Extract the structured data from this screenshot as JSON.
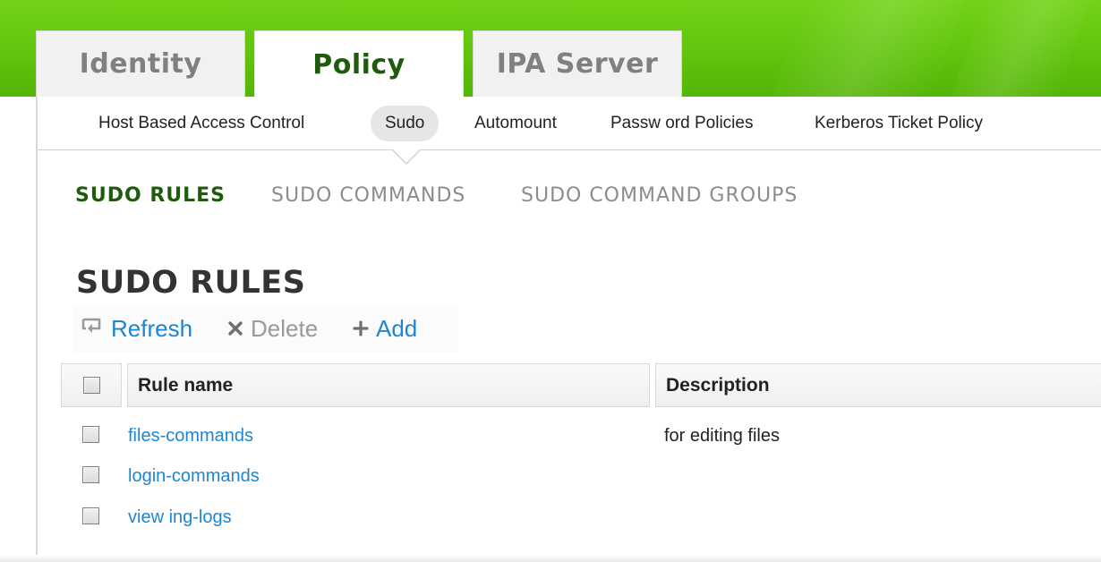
{
  "top_tabs": [
    {
      "label": "Identity",
      "active": false
    },
    {
      "label": "Policy",
      "active": true
    },
    {
      "label": "IPA Server",
      "active": false
    }
  ],
  "sub_nav": [
    {
      "label": "Host Based Access Control",
      "active": false
    },
    {
      "label": "Sudo",
      "active": true
    },
    {
      "label": "Automount",
      "active": false
    },
    {
      "label": "Passw ord Policies",
      "active": false
    },
    {
      "label": "Kerberos Ticket Policy",
      "active": false
    }
  ],
  "facets": [
    {
      "label": "SUDO RULES",
      "active": true
    },
    {
      "label": "SUDO COMMANDS",
      "active": false
    },
    {
      "label": "SUDO COMMAND GROUPS",
      "active": false
    }
  ],
  "page_title": "SUDO RULES",
  "actions": {
    "refresh": {
      "label": "Refresh",
      "icon": "refresh-icon",
      "enabled": true
    },
    "delete": {
      "label": "Delete",
      "icon": "delete-x-icon",
      "enabled": false
    },
    "add": {
      "label": "Add",
      "icon": "plus-icon",
      "enabled": true
    }
  },
  "table": {
    "columns": [
      "Rule name",
      "Description"
    ],
    "rows": [
      {
        "name": "files-commands",
        "description": "for editing files",
        "checked": false
      },
      {
        "name": "login-commands",
        "description": "",
        "checked": false
      },
      {
        "name": "view ing-logs",
        "description": "",
        "checked": false
      }
    ]
  },
  "colors": {
    "banner_green": "#61c40c",
    "active_green": "#1e5c0c",
    "link_blue": "#1e86d1",
    "inactive_gray": "#8c8c8c"
  }
}
